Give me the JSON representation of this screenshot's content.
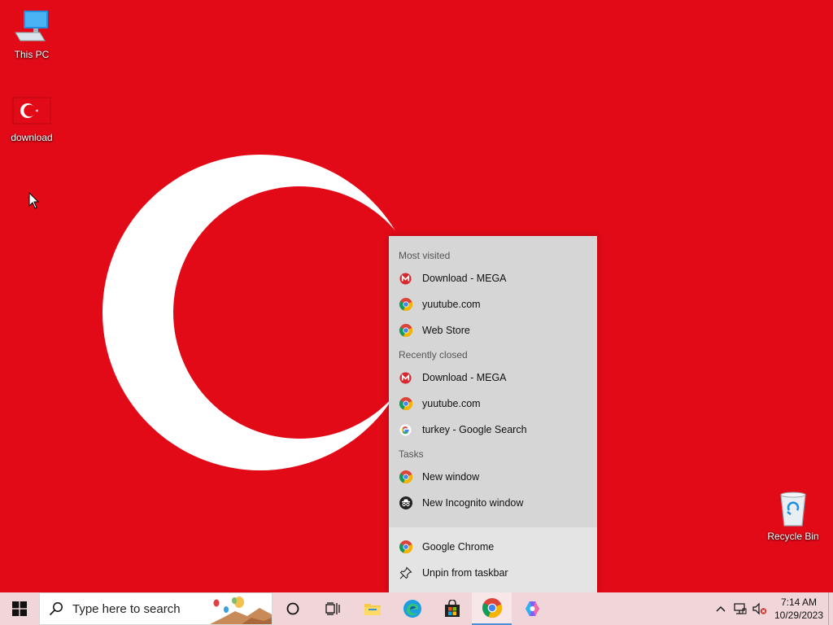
{
  "desktop": {
    "icons": [
      {
        "label": "This PC",
        "icon": "computer-icon"
      },
      {
        "label": "download",
        "icon": "turkey-flag-image-icon"
      },
      {
        "label": "Recycle Bin",
        "icon": "recycle-bin-icon"
      }
    ]
  },
  "jumplist": {
    "most_visited_header": "Most visited",
    "most_visited": [
      {
        "label": "Download - MEGA",
        "icon": "mega-icon"
      },
      {
        "label": "yuutube.com",
        "icon": "chrome-icon"
      },
      {
        "label": "Web Store",
        "icon": "chrome-icon"
      }
    ],
    "recently_closed_header": "Recently closed",
    "recently_closed": [
      {
        "label": "Download - MEGA",
        "icon": "mega-icon"
      },
      {
        "label": "yuutube.com",
        "icon": "chrome-icon"
      },
      {
        "label": "turkey - Google Search",
        "icon": "google-icon"
      }
    ],
    "tasks_header": "Tasks",
    "tasks": [
      {
        "label": "New window",
        "icon": "chrome-icon"
      },
      {
        "label": "New Incognito window",
        "icon": "incognito-icon"
      }
    ],
    "app_label": "Google Chrome",
    "unpin_label": "Unpin from taskbar"
  },
  "taskbar": {
    "search_placeholder": "Type here to search",
    "apps": [
      "cortana-icon",
      "task-view-icon",
      "file-explorer-icon",
      "edge-icon",
      "store-icon",
      "chrome-icon",
      "copilot-icon"
    ],
    "time": "7:14 AM",
    "date": "10/29/2023"
  },
  "colors": {
    "wallpaper": "#e30a17",
    "taskbar": "#f0d6d8",
    "jumplist": "#d6d6d6"
  }
}
